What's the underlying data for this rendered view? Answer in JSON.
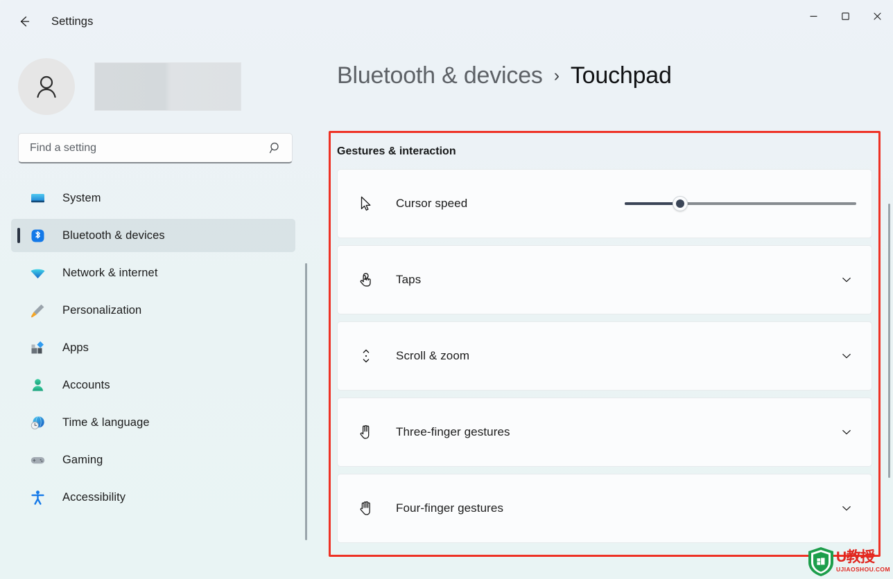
{
  "window": {
    "app_title": "Settings",
    "back_icon": "arrow-left-icon",
    "controls": {
      "minimize": "minimize-icon",
      "maximize": "maximize-icon",
      "close": "close-icon"
    }
  },
  "sidebar": {
    "account": {
      "avatar_icon": "person-avatar-icon",
      "name_redacted": true
    },
    "search": {
      "placeholder": "Find a setting",
      "value": "",
      "icon": "search-icon"
    },
    "items": [
      {
        "label": "System",
        "icon": "system-monitor-icon",
        "active": false
      },
      {
        "label": "Bluetooth & devices",
        "icon": "bluetooth-icon",
        "active": true
      },
      {
        "label": "Network & internet",
        "icon": "wifi-icon",
        "active": false
      },
      {
        "label": "Personalization",
        "icon": "paintbrush-icon",
        "active": false
      },
      {
        "label": "Apps",
        "icon": "apps-grid-icon",
        "active": false
      },
      {
        "label": "Accounts",
        "icon": "account-person-icon",
        "active": false
      },
      {
        "label": "Time & language",
        "icon": "clock-globe-icon",
        "active": false
      },
      {
        "label": "Gaming",
        "icon": "gamepad-icon",
        "active": false
      },
      {
        "label": "Accessibility",
        "icon": "accessibility-person-icon",
        "active": false
      }
    ]
  },
  "main": {
    "breadcrumb": {
      "parent": "Bluetooth & devices",
      "separator": "›",
      "current": "Touchpad"
    },
    "section": {
      "title": "Gestures & interaction",
      "highlighted": true,
      "highlight_color": "#ee3124"
    },
    "rows": [
      {
        "label": "Cursor speed",
        "icon": "mouse-cursor-icon",
        "type": "slider",
        "slider": {
          "value_percent": 24,
          "fill_color": "#3b4557",
          "track_color": "#868b90"
        }
      },
      {
        "label": "Taps",
        "icon": "tap-finger-icon",
        "type": "expander",
        "expanded": false,
        "chevron": "chevron-down-icon"
      },
      {
        "label": "Scroll & zoom",
        "icon": "scroll-vertical-icon",
        "type": "expander",
        "expanded": false,
        "chevron": "chevron-down-icon"
      },
      {
        "label": "Three-finger gestures",
        "icon": "three-finger-hand-icon",
        "type": "expander",
        "expanded": false,
        "chevron": "chevron-down-icon"
      },
      {
        "label": "Four-finger gestures",
        "icon": "four-finger-hand-icon",
        "type": "expander",
        "expanded": false,
        "chevron": "chevron-down-icon"
      }
    ]
  },
  "watermark": {
    "title": "U教授",
    "url": "UJIAOSHOU.COM",
    "icon": "shield-windows-logo-icon"
  },
  "colors": {
    "background": "#eef3f7",
    "card": "#fbfcfd",
    "accent_selection": "#2a3342",
    "bluetooth_blue": "#1479e8",
    "highlight_red": "#ee3124"
  }
}
